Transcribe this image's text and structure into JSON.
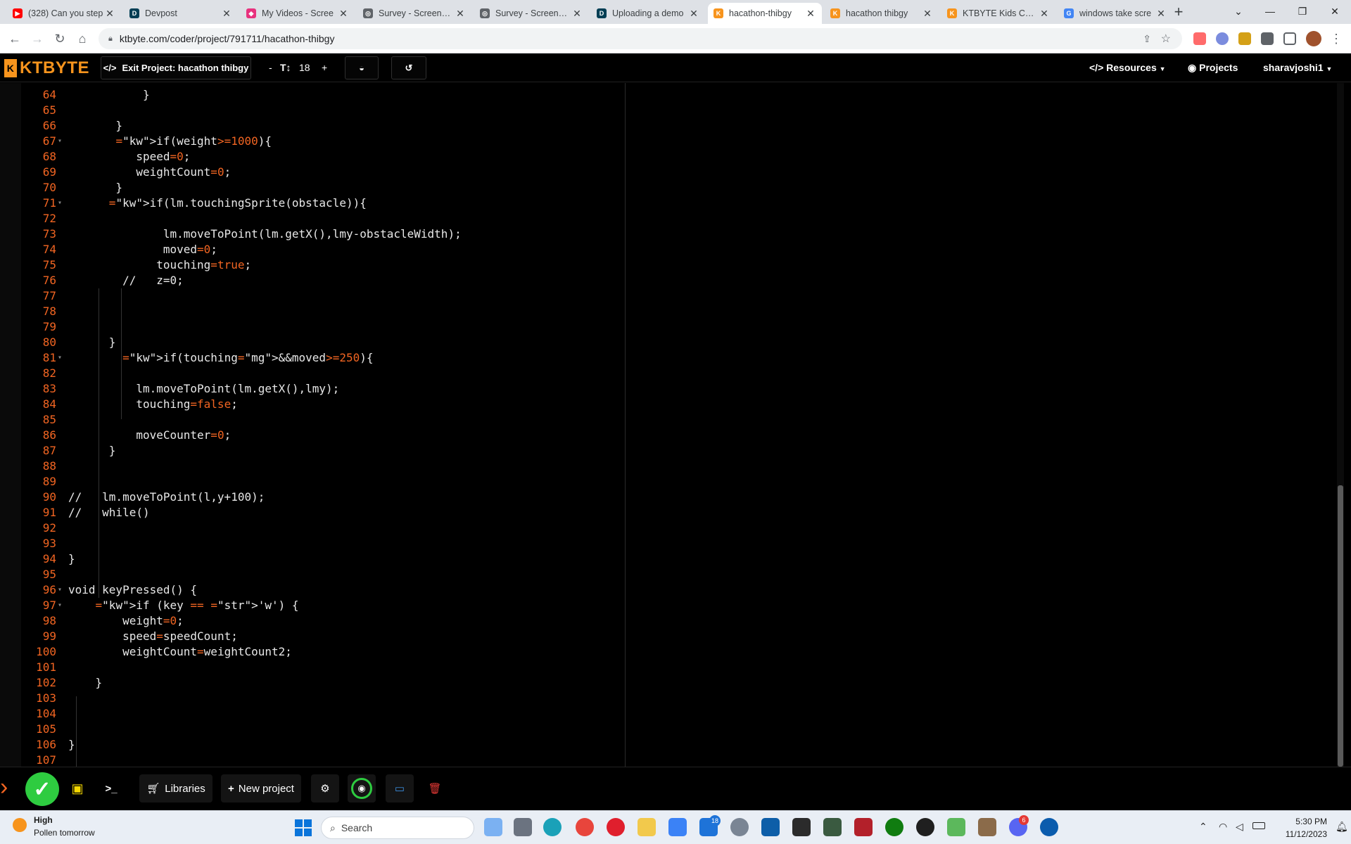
{
  "browser": {
    "tabs": [
      {
        "title": "(328) Can you step",
        "color": "#ff0000",
        "glyph": "▶",
        "active": false
      },
      {
        "title": "Devpost",
        "color": "#003e54",
        "glyph": "D",
        "active": false
      },
      {
        "title": "My Videos - Scree",
        "color": "#e8327e",
        "glyph": "◆",
        "active": false
      },
      {
        "title": "Survey - Screencas",
        "color": "#5f6368",
        "glyph": "◎",
        "active": false
      },
      {
        "title": "Survey - Screencas",
        "color": "#5f6368",
        "glyph": "◎",
        "active": false
      },
      {
        "title": "Uploading a demo",
        "color": "#003e54",
        "glyph": "D",
        "active": false
      },
      {
        "title": "hacathon-thibgy",
        "color": "#f7941d",
        "glyph": "K",
        "active": true
      },
      {
        "title": "hacathon thibgy",
        "color": "#f7941d",
        "glyph": "K",
        "active": false
      },
      {
        "title": "KTBYTE Kids Codin",
        "color": "#f7941d",
        "glyph": "K",
        "active": false
      },
      {
        "title": "windows take scre",
        "color": "#4285f4",
        "glyph": "G",
        "active": false
      }
    ],
    "new_tab": "+",
    "url": "ktbyte.com/coder/project/791711/hacathon-thibgy"
  },
  "app": {
    "brand": "KTBYTE",
    "exit_label": "Exit Project: hacathon thibgy",
    "font_minus": "-",
    "font_icon": "T↕",
    "font_size": "18",
    "font_plus": "+",
    "resources": "Resources",
    "projects": "Projects",
    "user": "sharavjoshi1"
  },
  "code_lines": [
    {
      "n": "64",
      "t": "           }",
      "fold": false
    },
    {
      "n": "65",
      "t": "",
      "fold": false
    },
    {
      "n": "66",
      "t": "       }",
      "fold": false
    },
    {
      "n": "67",
      "t": "       if(weight>=1000){",
      "fold": true
    },
    {
      "n": "68",
      "t": "          speed=0;",
      "fold": false
    },
    {
      "n": "69",
      "t": "          weightCount=0;",
      "fold": false
    },
    {
      "n": "70",
      "t": "       }",
      "fold": false
    },
    {
      "n": "71",
      "t": "      if(lm.touchingSprite(obstacle)){",
      "fold": true
    },
    {
      "n": "72",
      "t": "",
      "fold": false
    },
    {
      "n": "73",
      "t": "              lm.moveToPoint(lm.getX(),lmy-obstacleWidth);",
      "fold": false
    },
    {
      "n": "74",
      "t": "              moved=0;",
      "fold": false
    },
    {
      "n": "75",
      "t": "             touching=true;",
      "fold": false
    },
    {
      "n": "76",
      "t": "        //   z=0;",
      "fold": false
    },
    {
      "n": "77",
      "t": "",
      "fold": false
    },
    {
      "n": "78",
      "t": "",
      "fold": false
    },
    {
      "n": "79",
      "t": "",
      "fold": false
    },
    {
      "n": "80",
      "t": "      }",
      "fold": false
    },
    {
      "n": "81",
      "t": "        if(touching&&moved>=250){",
      "fold": true
    },
    {
      "n": "82",
      "t": "",
      "fold": false
    },
    {
      "n": "83",
      "t": "          lm.moveToPoint(lm.getX(),lmy);",
      "fold": false
    },
    {
      "n": "84",
      "t": "          touching=false;",
      "fold": false
    },
    {
      "n": "85",
      "t": "",
      "fold": false
    },
    {
      "n": "86",
      "t": "          moveCounter=0;",
      "fold": false
    },
    {
      "n": "87",
      "t": "      }",
      "fold": false
    },
    {
      "n": "88",
      "t": "",
      "fold": false
    },
    {
      "n": "89",
      "t": "",
      "fold": false
    },
    {
      "n": "90",
      "t": "//   lm.moveToPoint(l,y+100);",
      "fold": false
    },
    {
      "n": "91",
      "t": "//   while()",
      "fold": false
    },
    {
      "n": "92",
      "t": "",
      "fold": false
    },
    {
      "n": "93",
      "t": "",
      "fold": false
    },
    {
      "n": "94",
      "t": "}",
      "fold": false
    },
    {
      "n": "95",
      "t": "",
      "fold": false
    },
    {
      "n": "96",
      "t": "void keyPressed() {",
      "fold": true
    },
    {
      "n": "97",
      "t": "    if (key == 'w') {",
      "fold": true
    },
    {
      "n": "98",
      "t": "        weight=0;",
      "fold": false
    },
    {
      "n": "99",
      "t": "        speed=speedCount;",
      "fold": false
    },
    {
      "n": "100",
      "t": "        weightCount=weightCount2;",
      "fold": false
    },
    {
      "n": "101",
      "t": "",
      "fold": false
    },
    {
      "n": "102",
      "t": "    }",
      "fold": false
    },
    {
      "n": "103",
      "t": "",
      "fold": false
    },
    {
      "n": "104",
      "t": "",
      "fold": false
    },
    {
      "n": "105",
      "t": "",
      "fold": false
    },
    {
      "n": "106",
      "t": "}",
      "fold": false
    },
    {
      "n": "107",
      "t": "",
      "fold": false
    }
  ],
  "bottom": {
    "libraries": "Libraries",
    "new_project": "New project"
  },
  "taskbar": {
    "weather_title": "High",
    "weather_sub": "Pollen tomorrow",
    "search": "Search",
    "time": "5:30 PM",
    "date": "11/12/2023",
    "badge_mail": "18",
    "badge_discord": "6"
  },
  "colors": {
    "accent": "#f7941d",
    "line_number": "#f26522",
    "code_text": "#e8e8e8",
    "run_green": "#2ecc40"
  }
}
